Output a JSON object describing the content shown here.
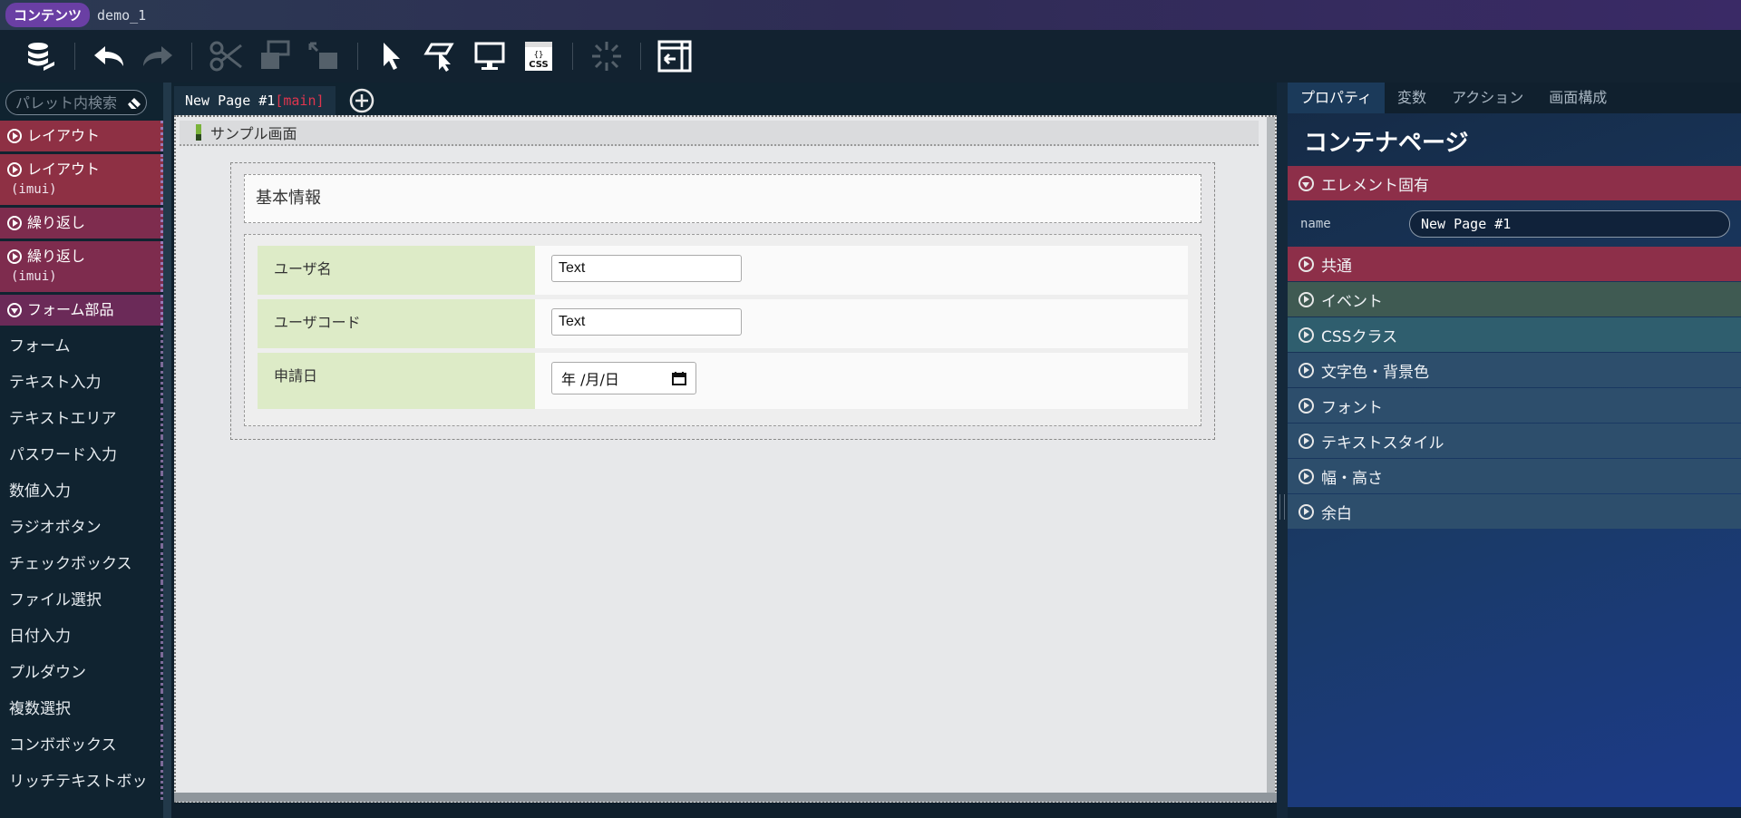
{
  "titlebar": {
    "app_name": "コンテンツ",
    "project": "demo_1"
  },
  "toolbar": {
    "buttons": [
      {
        "icon": "database-icon",
        "enabled": true
      },
      {
        "icon": "undo-icon",
        "enabled": true
      },
      {
        "icon": "redo-icon",
        "enabled": false
      },
      {
        "icon": "cut-icon",
        "enabled": false
      },
      {
        "icon": "copy-icon",
        "enabled": false
      },
      {
        "icon": "paste-icon",
        "enabled": false
      },
      {
        "icon": "select-cursor-icon",
        "enabled": true
      },
      {
        "icon": "select-area-icon",
        "enabled": true
      },
      {
        "icon": "preview-monitor-icon",
        "enabled": true
      },
      {
        "icon": "css-file-icon",
        "enabled": true
      },
      {
        "icon": "loading-spinner-icon",
        "enabled": false
      },
      {
        "icon": "collapse-panel-icon",
        "enabled": true
      }
    ]
  },
  "palette": {
    "search_placeholder": "パレット内検索",
    "categories": [
      {
        "label": "レイアウト",
        "sub": "",
        "open": false
      },
      {
        "label": "レイアウト",
        "sub": "(imui)",
        "open": false
      },
      {
        "label": "繰り返し",
        "sub": "",
        "open": false
      },
      {
        "label": "繰り返し",
        "sub": "(imui)",
        "open": false
      },
      {
        "label": "フォーム部品",
        "sub": "",
        "open": true
      }
    ],
    "items": [
      "フォーム",
      "テキスト入力",
      "テキストエリア",
      "パスワード入力",
      "数値入力",
      "ラジオボタン",
      "チェックボックス",
      "ファイル選択",
      "日付入力",
      "プルダウン",
      "複数選択",
      "コンボボックス",
      "リッチテキストボッ"
    ]
  },
  "editor": {
    "tab": {
      "name": "New Page #1",
      "tag": "[main]"
    },
    "page_title": "サンプル画面",
    "section_title": "基本情報",
    "form": [
      {
        "label": "ユーザ名",
        "value": "Text"
      },
      {
        "label": "ユーザコード",
        "value": "Text"
      },
      {
        "label": "申請日",
        "date_display": "年 /月/日"
      }
    ]
  },
  "right_panel": {
    "tabs": [
      "プロパティ",
      "変数",
      "アクション",
      "画面構成"
    ],
    "active_tab": "プロパティ",
    "title": "コンテナページ",
    "sections": [
      {
        "label": "エレメント固有",
        "open": true,
        "color": "#8d2f49"
      },
      {
        "label": "共通",
        "open": false,
        "color": "#8d2f49"
      },
      {
        "label": "イベント",
        "open": false,
        "color": "#3f5a52"
      },
      {
        "label": "CSSクラス",
        "open": false,
        "color": "#2f5e6e"
      },
      {
        "label": "文字色・背景色",
        "open": false,
        "color": "#2d4e6c"
      },
      {
        "label": "フォント",
        "open": false,
        "color": "#2d4e6c"
      },
      {
        "label": "テキストスタイル",
        "open": false,
        "color": "#2d4e6c"
      },
      {
        "label": "幅・高さ",
        "open": false,
        "color": "#2d4e6c"
      },
      {
        "label": "余白",
        "open": false,
        "color": "#2d4e6c"
      }
    ],
    "property": {
      "name": "name",
      "value": "New Page #1"
    }
  }
}
